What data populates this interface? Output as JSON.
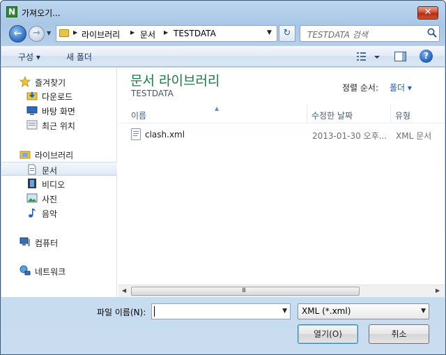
{
  "window": {
    "title": "가져오기...",
    "close_glyph": "✕"
  },
  "nav_buttons": {
    "back_glyph": "←",
    "forward_glyph": "→",
    "history_glyph": "▼",
    "refresh_glyph": "↻"
  },
  "address": {
    "crumbs": [
      "라이브러리",
      "문서",
      "TESTDATA"
    ],
    "arrow_glyph": "▶",
    "dropdown_glyph": "▼"
  },
  "search": {
    "placeholder": "TESTDATA 검색"
  },
  "commands": {
    "organize": "구성 ▾",
    "new_folder": "새 폴더",
    "help": "?"
  },
  "nav_pane": {
    "favorites_header": "즐겨찾기",
    "favorites": [
      "다운로드",
      "바탕 화면",
      "최근 위치"
    ],
    "libraries_header": "라이브러리",
    "libraries": [
      "문서",
      "비디오",
      "사진",
      "음악"
    ],
    "selected": "문서",
    "computer": "컴퓨터",
    "network": "네트워크"
  },
  "library": {
    "title": "문서 라이브러리",
    "subtitle": "TESTDATA",
    "arrange_label": "정렬 순서:",
    "arrange_value": "폴더 ▾"
  },
  "columns": {
    "name": "이름",
    "modified": "수정한 날짜",
    "type": "유형",
    "sort_glyph": "▲"
  },
  "files": [
    {
      "name": "clash.xml",
      "modified": "2013-01-30 오후...",
      "type": "XML 문서"
    }
  ],
  "scrollbar": {
    "left_glyph": "◀",
    "right_glyph": "▶",
    "grip": "III"
  },
  "bottom": {
    "filename_label": "파일 이름(N):",
    "filename_value": "",
    "filter_value": "XML (*.xml)",
    "combo_glyph": "▼",
    "open_button": "열기(O)",
    "cancel_button": "취소"
  },
  "colors": {
    "accent_green": "#1e7b46",
    "link_blue": "#1f5cc4",
    "window_frame": "#bcd6ee"
  }
}
